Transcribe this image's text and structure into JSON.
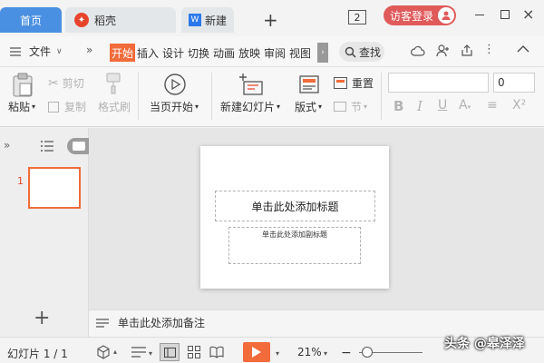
{
  "tabs": {
    "home": "首页",
    "daoke": "稻壳",
    "new_doc": "新建"
  },
  "window": {
    "badge": "2",
    "login": "访客登录"
  },
  "menu": {
    "file": "文件",
    "ribbon_tabs": [
      "开始",
      "插入",
      "设计",
      "切换",
      "动画",
      "放映",
      "审阅",
      "视图"
    ],
    "search": "查找"
  },
  "ribbon": {
    "paste": "粘贴",
    "cut": "剪切",
    "copy": "复制",
    "format_painter": "格式刷",
    "play_current": "当页开始",
    "new_slide": "新建幻灯片",
    "layout": "版式",
    "reset": "重置",
    "section": "节",
    "font_size": "0"
  },
  "slide": {
    "number": "1",
    "title_placeholder": "单击此处添加标题",
    "subtitle_placeholder": "单击此处添加副标题"
  },
  "notes": {
    "placeholder": "单击此处添加备注"
  },
  "status": {
    "slide_count": "幻灯片 1 / 1",
    "zoom": "21%",
    "watermark": "头条 @皋泽泽"
  },
  "colors": {
    "accent": "#4a90e2",
    "brand_orange": "#e8442d",
    "login_red": "#e05a5a",
    "active_tab": "#f26b3a"
  }
}
